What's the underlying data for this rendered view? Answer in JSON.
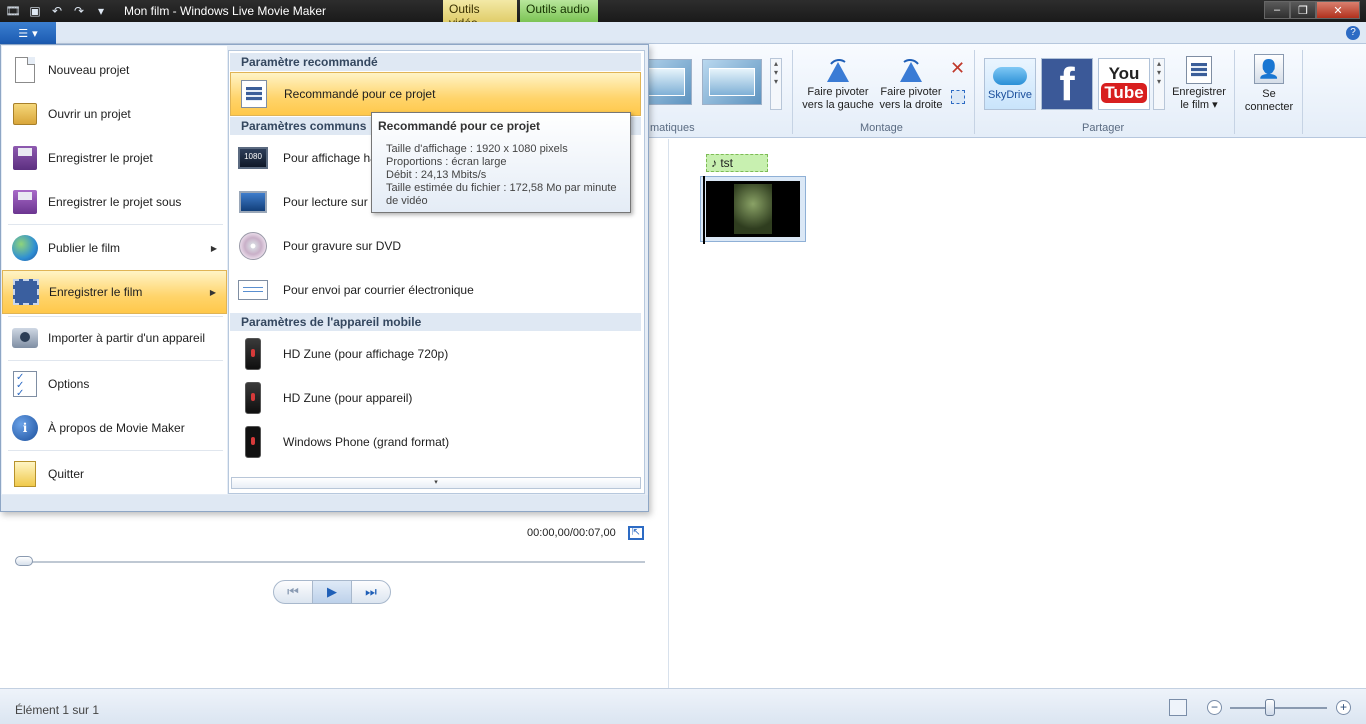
{
  "window": {
    "title": "Mon film - Windows Live Movie Maker",
    "tool_tabs": [
      "Outils vidéo",
      "Outils audio"
    ],
    "controls": {
      "minimize": "–",
      "maximize": "❐",
      "close": "✕"
    }
  },
  "quick_access": {
    "save_icon": "save-icon",
    "undo_icon": "undo-icon",
    "redo_icon": "redo-icon",
    "customize_icon": "dropdown-icon"
  },
  "ribbon": {
    "help": "?",
    "groups": {
      "themes_partial": "matiques",
      "montage": "Montage",
      "partager": "Partager"
    },
    "buttons": {
      "rotate_left": "Faire pivoter vers la gauche",
      "rotate_right": "Faire pivoter vers la droite",
      "skydrive": "SkyDrive",
      "facebook": "f",
      "youtube_top": "You",
      "youtube_bottom": "Tube",
      "save_movie": "Enregistrer le film",
      "sign_in": "Se connecter"
    }
  },
  "app_menu": {
    "items": [
      {
        "label": "Nouveau projet",
        "icon": "new-document-icon"
      },
      {
        "label": "Ouvrir un projet",
        "icon": "open-folder-icon"
      },
      {
        "label": "Enregistrer le projet",
        "icon": "save-disk-icon"
      },
      {
        "label": "Enregistrer le projet sous",
        "icon": "save-as-icon"
      },
      {
        "label": "Publier le film",
        "icon": "globe-icon"
      },
      {
        "label": "Enregistrer le film",
        "icon": "film-icon"
      },
      {
        "label": "Importer à partir d'un appareil",
        "icon": "camera-icon"
      },
      {
        "label": "Options",
        "icon": "checklist-icon"
      },
      {
        "label": "À propos de Movie Maker",
        "icon": "info-icon"
      },
      {
        "label": "Quitter",
        "icon": "exit-icon"
      }
    ],
    "submenu": {
      "sections": {
        "recommended": "Paramètre recommandé",
        "common": "Paramètres communs",
        "mobile": "Paramètres de l'appareil mobile"
      },
      "items": {
        "recommended": "Recommandé pour ce projet",
        "hd_display": "Pour affichage ha",
        "computer": "Pour lecture sur o",
        "dvd": "Pour gravure sur DVD",
        "email": "Pour envoi par courrier électronique",
        "zune_720": "HD Zune (pour affichage 720p)",
        "zune_device": "HD Zune (pour appareil)",
        "windows_phone": "Windows Phone (grand format)"
      },
      "hd_badge": "1080",
      "scroll_more": "▾"
    }
  },
  "tooltip": {
    "title": "Recommandé pour ce projet",
    "lines": [
      "Taille d'affichage : 1920 x 1080 pixels",
      "Proportions : écran large",
      "Débit : 24,13 Mbits/s",
      "Taille estimée du fichier : 172,58 Mo par minute de vidéo"
    ]
  },
  "storyboard": {
    "audio_clip": "♪ tst"
  },
  "player": {
    "timecode": "00:00,00/00:07,00",
    "fullscreen_icon": "⇱",
    "prev": "⏮",
    "play": "▶",
    "next": "⏭"
  },
  "status": {
    "text": "Élément 1 sur 1",
    "zoom_minus": "−",
    "zoom_plus": "+"
  }
}
